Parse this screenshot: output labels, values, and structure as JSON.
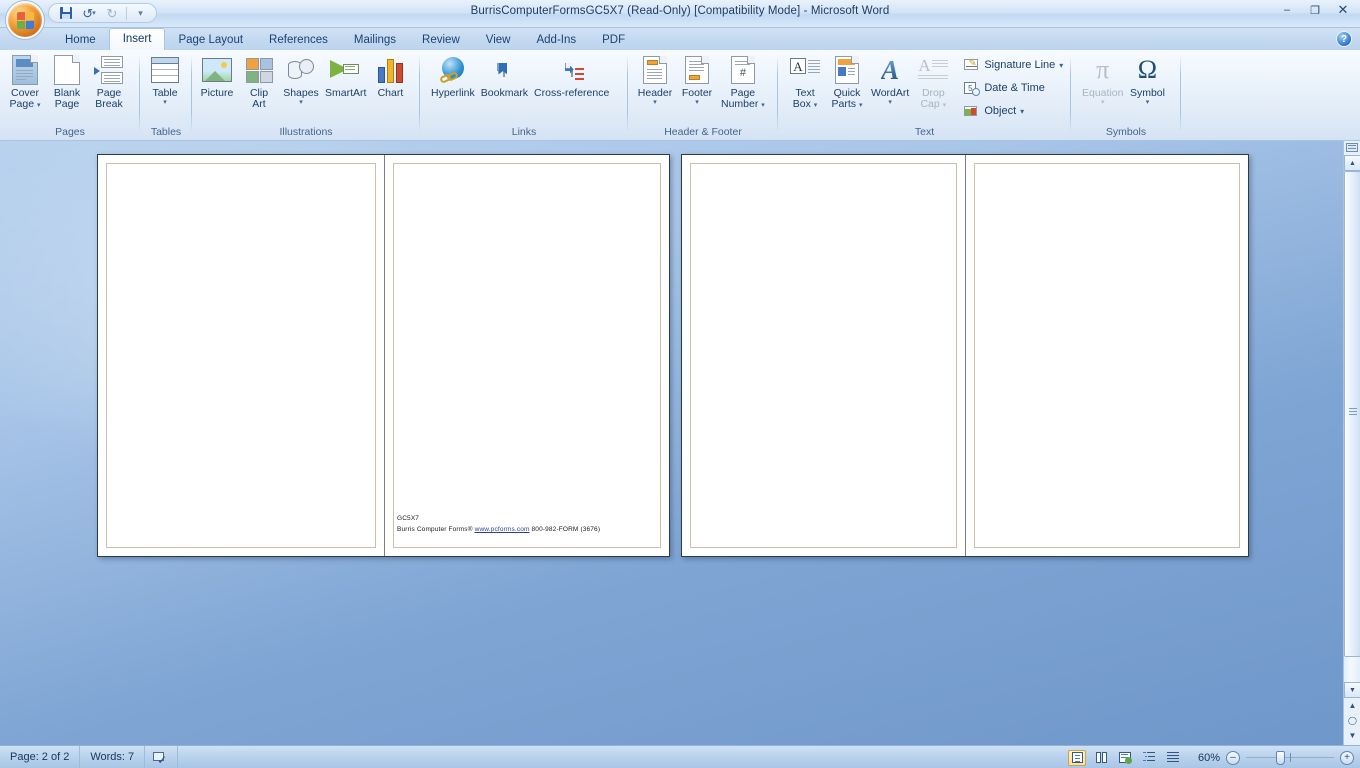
{
  "window": {
    "title": "BurrisComputerFormsGC5X7 (Read-Only) [Compatibility Mode] - Microsoft Word",
    "minimize": "–",
    "maximize": "❐",
    "close": "✕",
    "help_label": "?"
  },
  "quick_access": {
    "save": "save-icon",
    "undo": "undo-icon",
    "redo": "redo-icon",
    "customize": "customize-qat-icon"
  },
  "tabs": [
    {
      "label": "Home",
      "active": false
    },
    {
      "label": "Insert",
      "active": true
    },
    {
      "label": "Page Layout",
      "active": false
    },
    {
      "label": "References",
      "active": false
    },
    {
      "label": "Mailings",
      "active": false
    },
    {
      "label": "Review",
      "active": false
    },
    {
      "label": "View",
      "active": false
    },
    {
      "label": "Add-Ins",
      "active": false
    },
    {
      "label": "PDF",
      "active": false
    }
  ],
  "ribbon": {
    "groups": [
      {
        "name": "Pages",
        "label": "Pages",
        "items": [
          {
            "label": "Cover Page",
            "line1": "Cover",
            "line2": "Page",
            "dropdown": true
          },
          {
            "label": "Blank Page",
            "line1": "Blank",
            "line2": "Page",
            "dropdown": false
          },
          {
            "label": "Page Break",
            "line1": "Page",
            "line2": "Break",
            "dropdown": false
          }
        ]
      },
      {
        "name": "Tables",
        "label": "Tables",
        "items": [
          {
            "label": "Table",
            "line1": "Table",
            "line2": "",
            "dropdown": true
          }
        ]
      },
      {
        "name": "Illustrations",
        "label": "Illustrations",
        "items": [
          {
            "label": "Picture",
            "line1": "Picture",
            "line2": "",
            "dropdown": false
          },
          {
            "label": "Clip Art",
            "line1": "Clip",
            "line2": "Art",
            "dropdown": false
          },
          {
            "label": "Shapes",
            "line1": "Shapes",
            "line2": "",
            "dropdown": true
          },
          {
            "label": "SmartArt",
            "line1": "SmartArt",
            "line2": "",
            "dropdown": false
          },
          {
            "label": "Chart",
            "line1": "Chart",
            "line2": "",
            "dropdown": false
          }
        ]
      },
      {
        "name": "Links",
        "label": "Links",
        "items": [
          {
            "label": "Hyperlink",
            "line1": "Hyperlink",
            "line2": "",
            "dropdown": false
          },
          {
            "label": "Bookmark",
            "line1": "Bookmark",
            "line2": "",
            "dropdown": false
          },
          {
            "label": "Cross-reference",
            "line1": "Cross-reference",
            "line2": "",
            "dropdown": false
          }
        ]
      },
      {
        "name": "Header & Footer",
        "label": "Header & Footer",
        "items": [
          {
            "label": "Header",
            "line1": "Header",
            "line2": "",
            "dropdown": true
          },
          {
            "label": "Footer",
            "line1": "Footer",
            "line2": "",
            "dropdown": true
          },
          {
            "label": "Page Number",
            "line1": "Page",
            "line2": "Number",
            "dropdown": true
          }
        ]
      },
      {
        "name": "Text",
        "label": "Text",
        "items": [
          {
            "label": "Text Box",
            "line1": "Text",
            "line2": "Box",
            "dropdown": true,
            "disabled": false
          },
          {
            "label": "Quick Parts",
            "line1": "Quick",
            "line2": "Parts",
            "dropdown": true,
            "disabled": false
          },
          {
            "label": "WordArt",
            "line1": "WordArt",
            "line2": "",
            "dropdown": true,
            "disabled": false
          },
          {
            "label": "Drop Cap",
            "line1": "Drop",
            "line2": "Cap",
            "dropdown": true,
            "disabled": true
          }
        ],
        "small_items": [
          {
            "label": "Signature Line",
            "dropdown": true,
            "icon": "signature-line-icon"
          },
          {
            "label": "Date & Time",
            "dropdown": false,
            "icon": "date-time-icon"
          },
          {
            "label": "Object",
            "dropdown": true,
            "icon": "object-icon"
          }
        ]
      },
      {
        "name": "Symbols",
        "label": "Symbols",
        "items": [
          {
            "label": "Equation",
            "line1": "Equation",
            "line2": "",
            "glyph": "π",
            "dropdown": true,
            "disabled": true
          },
          {
            "label": "Symbol",
            "line1": "Symbol",
            "line2": "",
            "glyph": "Ω",
            "dropdown": true,
            "disabled": false
          }
        ]
      }
    ]
  },
  "document": {
    "spreads": [
      {
        "pages": [
          {
            "text_line1": "",
            "text_line2_pre": "",
            "text_link": "",
            "text_line2_post": ""
          },
          {
            "text_line1": "GC5X7",
            "text_line2_pre": "Burris Computer Forms® ",
            "text_link": "www.pcforms.com",
            "text_line2_post": " 800-982-FORM (3676)"
          }
        ]
      },
      {
        "pages": [
          {
            "text_line1": "",
            "text_line2_pre": "",
            "text_link": "",
            "text_line2_post": ""
          },
          {
            "text_line1": "",
            "text_line2_pre": "",
            "text_link": "",
            "text_line2_post": ""
          }
        ]
      }
    ]
  },
  "status_bar": {
    "page": "Page: 2 of 2",
    "words": "Words: 7",
    "proofing_icon": "spelling-check-icon",
    "view_buttons": [
      {
        "name": "print-layout-view",
        "selected": true
      },
      {
        "name": "full-screen-reading-view",
        "selected": false
      },
      {
        "name": "web-layout-view",
        "selected": false
      },
      {
        "name": "outline-view",
        "selected": false
      },
      {
        "name": "draft-view",
        "selected": false
      }
    ],
    "zoom_level": "60%",
    "zoom_out": "–",
    "zoom_in": "+"
  },
  "colors": {
    "accent": "#2b5fa8",
    "ribbon_label": "#44648c",
    "title_text": "#1f3b63",
    "desk_blue": "#7fa5d4",
    "link": "#2b3fa0"
  }
}
